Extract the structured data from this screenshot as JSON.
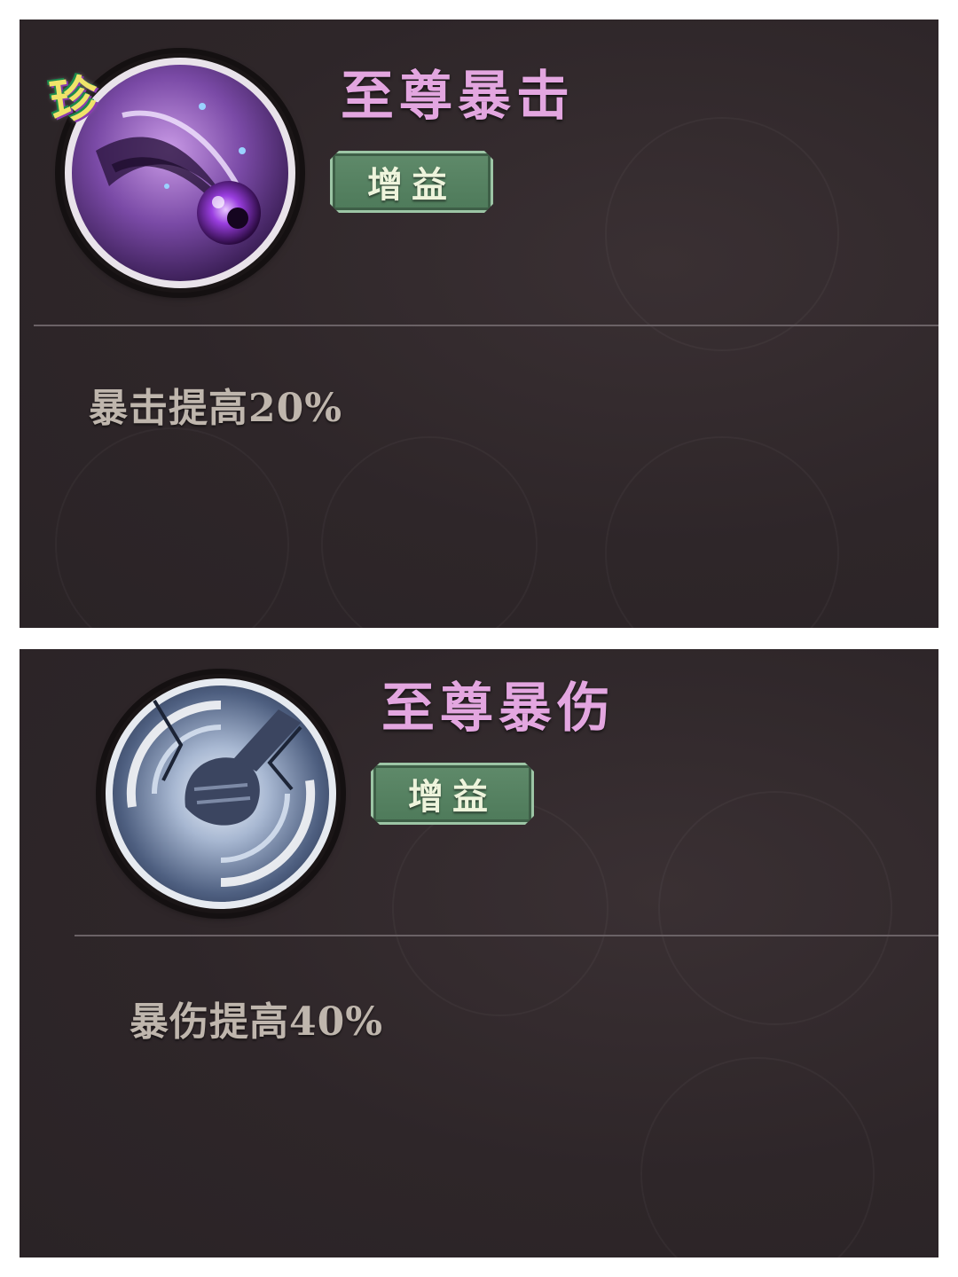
{
  "buffs": [
    {
      "icon": "purple-orb-icon",
      "badge": "珍",
      "title": "至尊暴击",
      "tag": "增益",
      "description": "暴击提高20%",
      "title_color": "#e3a6e0",
      "tag_color": "#5f8a6a"
    },
    {
      "icon": "fist-vortex-icon",
      "title": "至尊暴伤",
      "tag": "增益",
      "description": "暴伤提高40%",
      "title_color": "#e3a6e0",
      "tag_color": "#5f8a6a"
    }
  ]
}
